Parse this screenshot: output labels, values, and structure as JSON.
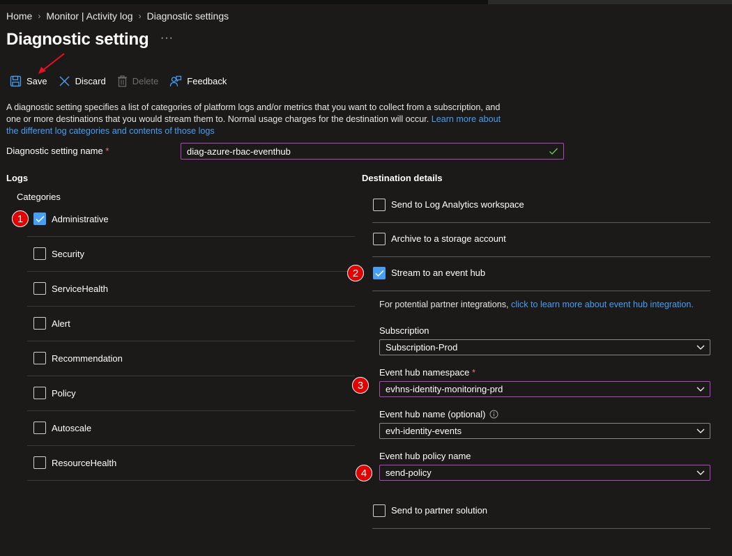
{
  "breadcrumb": {
    "home": "Home",
    "monitor": "Monitor | Activity log",
    "current": "Diagnostic settings"
  },
  "page": {
    "title": "Diagnostic setting",
    "more": "···"
  },
  "toolbar": {
    "save": "Save",
    "discard": "Discard",
    "delete": "Delete",
    "feedback": "Feedback"
  },
  "description": {
    "text": "A diagnostic setting specifies a list of categories of platform logs and/or metrics that you want to collect from a subscription, and one or more destinations that you would stream them to. Normal usage charges for the destination will occur.",
    "link": "Learn more about the different log categories and contents of those logs"
  },
  "setting_name": {
    "label": "Diagnostic setting name",
    "required": "*",
    "value": "diag-azure-rbac-eventhub"
  },
  "logs": {
    "heading": "Logs",
    "categories_label": "Categories",
    "items": [
      {
        "label": "Administrative",
        "checked": true
      },
      {
        "label": "Security",
        "checked": false
      },
      {
        "label": "ServiceHealth",
        "checked": false
      },
      {
        "label": "Alert",
        "checked": false
      },
      {
        "label": "Recommendation",
        "checked": false
      },
      {
        "label": "Policy",
        "checked": false
      },
      {
        "label": "Autoscale",
        "checked": false
      },
      {
        "label": "ResourceHealth",
        "checked": false
      }
    ]
  },
  "destination": {
    "heading": "Destination details",
    "options": [
      {
        "label": "Send to Log Analytics workspace",
        "checked": false
      },
      {
        "label": "Archive to a storage account",
        "checked": false
      },
      {
        "label": "Stream to an event hub",
        "checked": true
      },
      {
        "label": "Send to partner solution",
        "checked": false
      }
    ],
    "partner_text": "For potential partner integrations,",
    "partner_link": "click to learn more about event hub integration.",
    "subscription": {
      "label": "Subscription",
      "value": "Subscription-Prod"
    },
    "namespace": {
      "label": "Event hub namespace",
      "required": "*",
      "value": "evhns-identity-monitoring-prd"
    },
    "hub_name": {
      "label": "Event hub name (optional)",
      "value": "evh-identity-events"
    },
    "policy": {
      "label": "Event hub policy name",
      "value": "send-policy"
    }
  },
  "badges": [
    "1",
    "2",
    "3",
    "4"
  ],
  "colors": {
    "accent": "#479ef5",
    "focus_border": "#b146c2",
    "badge": "#e00000",
    "background": "#1b1a19"
  }
}
